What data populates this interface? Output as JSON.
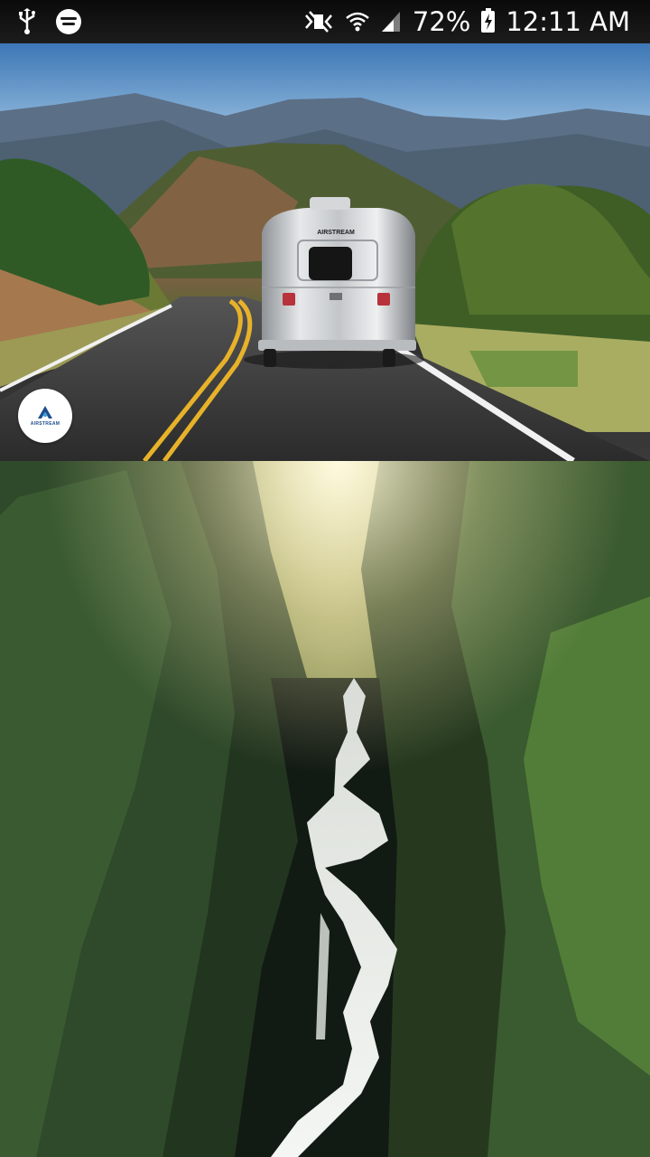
{
  "status_bar": {
    "battery_percent": "72%",
    "time": "12:11 AM",
    "icons": [
      "usb-icon",
      "spotify-icon",
      "mute-icon",
      "wifi-icon",
      "signal-icon",
      "battery-charging-icon"
    ]
  },
  "hero": {
    "trailer_brand": "AIRSTREAM",
    "logo_text": "AIRSTREAM"
  },
  "colors": {
    "status_bar_bg": "#111111",
    "logo_blue": "#1f4d8c",
    "road_line_yellow": "#e7b22a"
  }
}
